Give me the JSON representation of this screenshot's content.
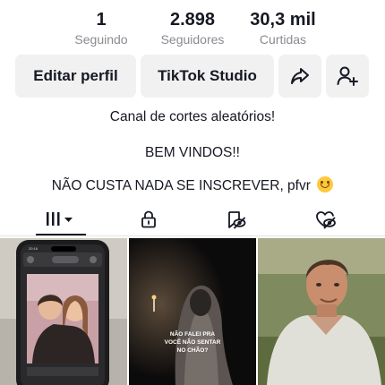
{
  "stats": [
    {
      "value": "1",
      "label": "Seguindo"
    },
    {
      "value": "2.898",
      "label": "Seguidores"
    },
    {
      "value": "30,3 mil",
      "label": "Curtidas"
    }
  ],
  "buttons": {
    "edit_profile": "Editar perfil",
    "tiktok_studio": "TikTok Studio",
    "share_icon": "share-arrow-icon",
    "add_friend_icon": "add-user-icon"
  },
  "bio": {
    "line1": "Canal de cortes aleatórios!",
    "line2": "BEM VINDOS!!",
    "line3": "NÃO CUSTA NADA SE INSCREVER, pfvr"
  },
  "tabs": [
    {
      "icon": "videos-grid-icon",
      "active": true
    },
    {
      "icon": "lock-icon",
      "active": false
    },
    {
      "icon": "reposts-hidden-icon",
      "active": false
    },
    {
      "icon": "liked-hidden-icon",
      "active": false
    }
  ],
  "videos": [
    {
      "thumb": "phone-screenshot-couple",
      "status_time": "20:16"
    },
    {
      "thumb": "hooded-figure-dark",
      "caption": "NÃO FALEI PRA VOCÊ NÃO SENTAR NO CHÃO?"
    },
    {
      "thumb": "man-in-field"
    }
  ]
}
